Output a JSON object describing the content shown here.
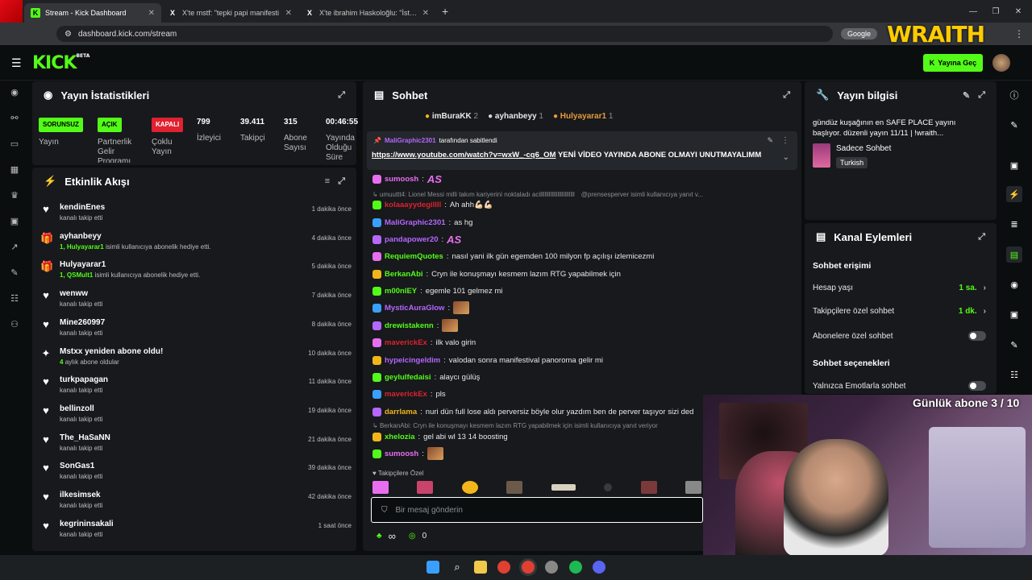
{
  "browser": {
    "tabs": [
      {
        "title": "Stream - Kick Dashboard",
        "icon": "kick-icon",
        "active": true
      },
      {
        "title": "X'te mstf: \"tepki papi manifesti",
        "icon": "x-icon",
        "active": false
      },
      {
        "title": "X'te ibrahim Haskoloğlu: \"İstan",
        "icon": "x-icon",
        "active": false
      }
    ],
    "new_tab": "+",
    "url": "dashboard.kick.com/stream",
    "google_label": "Google"
  },
  "overlay": {
    "brand": "WRAITH",
    "sub_goal": "Günlük abone 3 / 10"
  },
  "header": {
    "logo": "KICK",
    "logo_tag": "BETA",
    "go_live": "Yayına Geç"
  },
  "stats": {
    "title": "Yayın İstatistikleri",
    "items": [
      {
        "badge": "SORUNSUZ",
        "badge_color": "#53fc18",
        "label": "Yayın"
      },
      {
        "badge": "AÇIK",
        "badge_color": "#53fc18",
        "label": "Partnerlik Gelir Programı"
      },
      {
        "badge": "KAPALI",
        "badge_color": "#e0212f",
        "label": "Çoklu Yayın"
      },
      {
        "value": "799",
        "label": "İzleyici"
      },
      {
        "value": "39.411",
        "label": "Takipçi"
      },
      {
        "value": "315",
        "label": "Abone Sayısı"
      },
      {
        "value": "00:46:55",
        "label": "Yayında Olduğu Süre"
      }
    ]
  },
  "activity": {
    "title": "Etkinlik Akışı",
    "items": [
      {
        "icon": "heart-icon",
        "name": "kendinEnes",
        "sub": "kanalı takip etti",
        "time": "1 dakika önce"
      },
      {
        "icon": "gift-icon",
        "name": "ayhanbeyy",
        "sub_hl": "1, Hulyayarar1",
        "sub": "isimli kullanıcıya abonelik hediye etti.",
        "time": "4 dakika önce"
      },
      {
        "icon": "gift-icon",
        "name": "Hulyayarar1",
        "sub_hl": "1, QSMult1",
        "sub": "isimli kullanıcıya abonelik hediye etti.",
        "time": "5 dakika önce"
      },
      {
        "icon": "heart-icon",
        "name": "wenww",
        "sub": "kanalı takip etti",
        "time": "7 dakika önce"
      },
      {
        "icon": "heart-icon",
        "name": "Mine260997",
        "sub": "kanalı takip etti",
        "time": "8 dakika önce"
      },
      {
        "icon": "star-icon",
        "name": "Mstxx yeniden abone oldu!",
        "sub_hl": "4",
        "sub": "aylık abone oldular",
        "time": "10 dakika önce"
      },
      {
        "icon": "heart-icon",
        "name": "turkpapagan",
        "sub": "kanalı takip etti",
        "time": "11 dakika önce"
      },
      {
        "icon": "heart-icon",
        "name": "bellinzoll",
        "sub": "kanalı takip etti",
        "time": "19 dakika önce"
      },
      {
        "icon": "heart-icon",
        "name": "The_HaSaNN",
        "sub": "kanalı takip etti",
        "time": "21 dakika önce"
      },
      {
        "icon": "heart-icon",
        "name": "SonGas1",
        "sub": "kanalı takip etti",
        "time": "39 dakika önce"
      },
      {
        "icon": "heart-icon",
        "name": "ilkesimsek",
        "sub": "kanalı takip etti",
        "time": "42 dakika önce"
      },
      {
        "icon": "heart-icon",
        "name": "kegrininsakali",
        "sub": "kanalı takip etti",
        "time": "1 saat önce"
      }
    ]
  },
  "chat": {
    "title": "Sohbet",
    "top_gifters": [
      {
        "name": "imBuraKK",
        "count": "2",
        "color": "#f2b61a"
      },
      {
        "name": "ayhanbeyy",
        "count": "1",
        "color": "#d8d8d8"
      },
      {
        "name": "Hulyayarar1",
        "count": "1",
        "color": "#e89a3c"
      }
    ],
    "pinned": {
      "user": "MaliGraphic2301",
      "suffix": "tarafından sabitlendi",
      "link": "https://www.youtube.com/watch?v=wxW_-cq6_OM",
      "text": "YENİ VİDEO YAYINDA ABONE OLMAYI UNUTMAYALIMM"
    },
    "messages": [
      {
        "type": "msg",
        "user": "sumoosh",
        "color": "#e86ef0",
        "text": "",
        "emote": "AS"
      },
      {
        "type": "reply",
        "text": "umuuttt4: Lionel Messi milli takım kariyerini noktaladı acillllllllllllllllllllllll",
        "tail": "@prensesperver isimli kullanıcıya yanıt v..."
      },
      {
        "type": "msg",
        "user": "kolaaayydegillll",
        "color": "#e0212f",
        "text": "Ah ahh💪🏻💪🏻"
      },
      {
        "type": "msg",
        "user": "MaliGraphic2301",
        "color": "#b567ff",
        "text": "as hg"
      },
      {
        "type": "msg",
        "user": "pandapower20",
        "color": "#b567ff",
        "text": "",
        "emote": "AS"
      },
      {
        "type": "msg",
        "user": "RequiemQuotes",
        "color": "#53fc18",
        "text": "nasıl yani ilk gün egemden 100 milyon fp açılışı izlemicezmi"
      },
      {
        "type": "msg",
        "user": "BerkanAbi",
        "color": "#53fc18",
        "text": "Cryn ile konuşmayı kesmem lazım RTG yapabilmek için"
      },
      {
        "type": "msg",
        "user": "m00nlEY",
        "color": "#53fc18",
        "text": "egemle 101 gelmez mi"
      },
      {
        "type": "msg",
        "user": "MysticAuraGlow",
        "color": "#b567ff",
        "text": "",
        "emote": "img"
      },
      {
        "type": "msg",
        "user": "drewistakenn",
        "color": "#53fc18",
        "text": "",
        "emote": "img"
      },
      {
        "type": "msg",
        "user": "maverickEx",
        "color": "#e0212f",
        "text": "ilk valo girin"
      },
      {
        "type": "msg",
        "user": "hypeicingeldim",
        "color": "#b567ff",
        "text": "valodan sonra manifestival panoroma gelir mi"
      },
      {
        "type": "msg",
        "user": "geylulfedaisi",
        "color": "#53fc18",
        "text": "alaycı gülüş"
      },
      {
        "type": "msg",
        "user": "maverickEx",
        "color": "#e0212f",
        "text": "pls"
      },
      {
        "type": "msg",
        "user": "darrlama",
        "color": "#f2b61a",
        "text": "nuri dün full lose aldı perversiz böyle olur yazdım ben de perver taşıyor sizi ded"
      },
      {
        "type": "reply",
        "text": "BerkanAbi: Cryn ile konuşmayı kesmem lazım RTG yapabilmek için isimli kullanıcıya yanıt veriyor",
        "tail": ""
      },
      {
        "type": "msg",
        "user": "xhelozia",
        "color": "#53fc18",
        "text": "gel abi wl 13 14 boosting"
      },
      {
        "type": "msg",
        "user": "sumoosh",
        "color": "#e86ef0",
        "text": "",
        "emote": "img"
      }
    ],
    "followers_only": "Takipçilere Özel",
    "input_placeholder": "Bir mesaj gönderin",
    "footer_left": "∞",
    "footer_count": "0"
  },
  "stream_info": {
    "title": "Yayın bilgisi",
    "desc": "gündüz kuşağının en SAFE PLACE yayını başlıyor. düzenli yayın 11/11 | !wraith...",
    "category": "Sadece Sohbet",
    "tag": "Turkish"
  },
  "channel_actions": {
    "title": "Kanal Eylemleri",
    "chat_access": "Sohbet erişimi",
    "rows": [
      {
        "label": "Hesap yaşı",
        "value": "1 sa.",
        "kind": "link"
      },
      {
        "label": "Takipçilere özel sohbet",
        "value": "1 dk.",
        "kind": "link"
      },
      {
        "label": "Abonelere özel sohbet",
        "value": "",
        "kind": "toggle"
      }
    ],
    "chat_options": "Sohbet seçenekleri",
    "option_rows": [
      {
        "label": "Yalnızca Emotlarla sohbet",
        "kind": "toggle"
      }
    ]
  },
  "colors": {
    "accent": "#53fc18",
    "panel": "#17191c",
    "bg": "#0b0e0f"
  }
}
